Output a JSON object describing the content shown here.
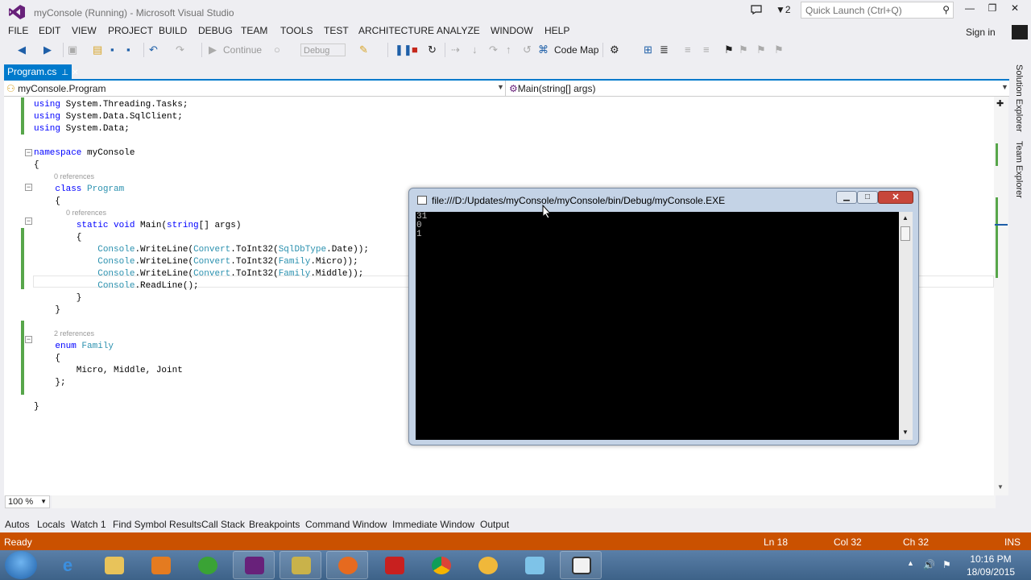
{
  "window": {
    "title": "myConsole (Running) - Microsoft Visual Studio",
    "filter_count": "2",
    "quick_launch_placeholder": "Quick Launch (Ctrl+Q)"
  },
  "menu": {
    "items": [
      "FILE",
      "EDIT",
      "VIEW",
      "PROJECT",
      "BUILD",
      "DEBUG",
      "TEAM",
      "TOOLS",
      "TEST",
      "ARCHITECTURE",
      "ANALYZE",
      "WINDOW",
      "HELP"
    ],
    "sign_in": "Sign in"
  },
  "toolbar": {
    "continue_label": "Continue",
    "config_value": "Debug",
    "code_map_label": "Code Map"
  },
  "document": {
    "tab_label": "Program.cs",
    "nav_type": "myConsole.Program",
    "nav_member": "Main(string[] args)"
  },
  "code": {
    "lines": [
      "using System.Threading.Tasks;",
      "using System.Data.SqlClient;",
      "using System.Data;",
      "",
      "namespace myConsole",
      "{",
      "    class Program",
      "    {",
      "        static void Main(string[] args)",
      "        {",
      "            Console.WriteLine(Convert.ToInt32(SqlDbType.Date));",
      "            Console.WriteLine(Convert.ToInt32(Family.Micro));",
      "            Console.WriteLine(Convert.ToInt32(Family.Middle));",
      "            Console.ReadLine();",
      "        }",
      "    }",
      "",
      "    enum Family",
      "    {",
      "        Micro, Middle, Joint",
      "    };",
      "",
      "}"
    ],
    "codelens_class": "0 references",
    "codelens_main": "0 references",
    "codelens_enum": "2 references"
  },
  "zoom": "100 %",
  "bottom_tabs": [
    "Autos",
    "Locals",
    "Watch 1",
    "Find Symbol Results",
    "Call Stack",
    "Breakpoints",
    "Command Window",
    "Immediate Window",
    "Output"
  ],
  "status": {
    "state": "Ready",
    "line": "Ln 18",
    "col": "Col 32",
    "ch": "Ch 32",
    "mode": "INS"
  },
  "side_tabs": [
    "Solution Explorer",
    "Team Explorer"
  ],
  "console": {
    "title": "file:///D:/Updates/myConsole/myConsole/bin/Debug/myConsole.EXE",
    "output": [
      "31",
      "0",
      "1"
    ]
  },
  "taskbar": {
    "time": "10:16 PM",
    "date": "18/09/2015"
  },
  "colors": {
    "accent": "#007acc",
    "status_bar": "#ca5100",
    "change_bar": "#57a64a"
  }
}
